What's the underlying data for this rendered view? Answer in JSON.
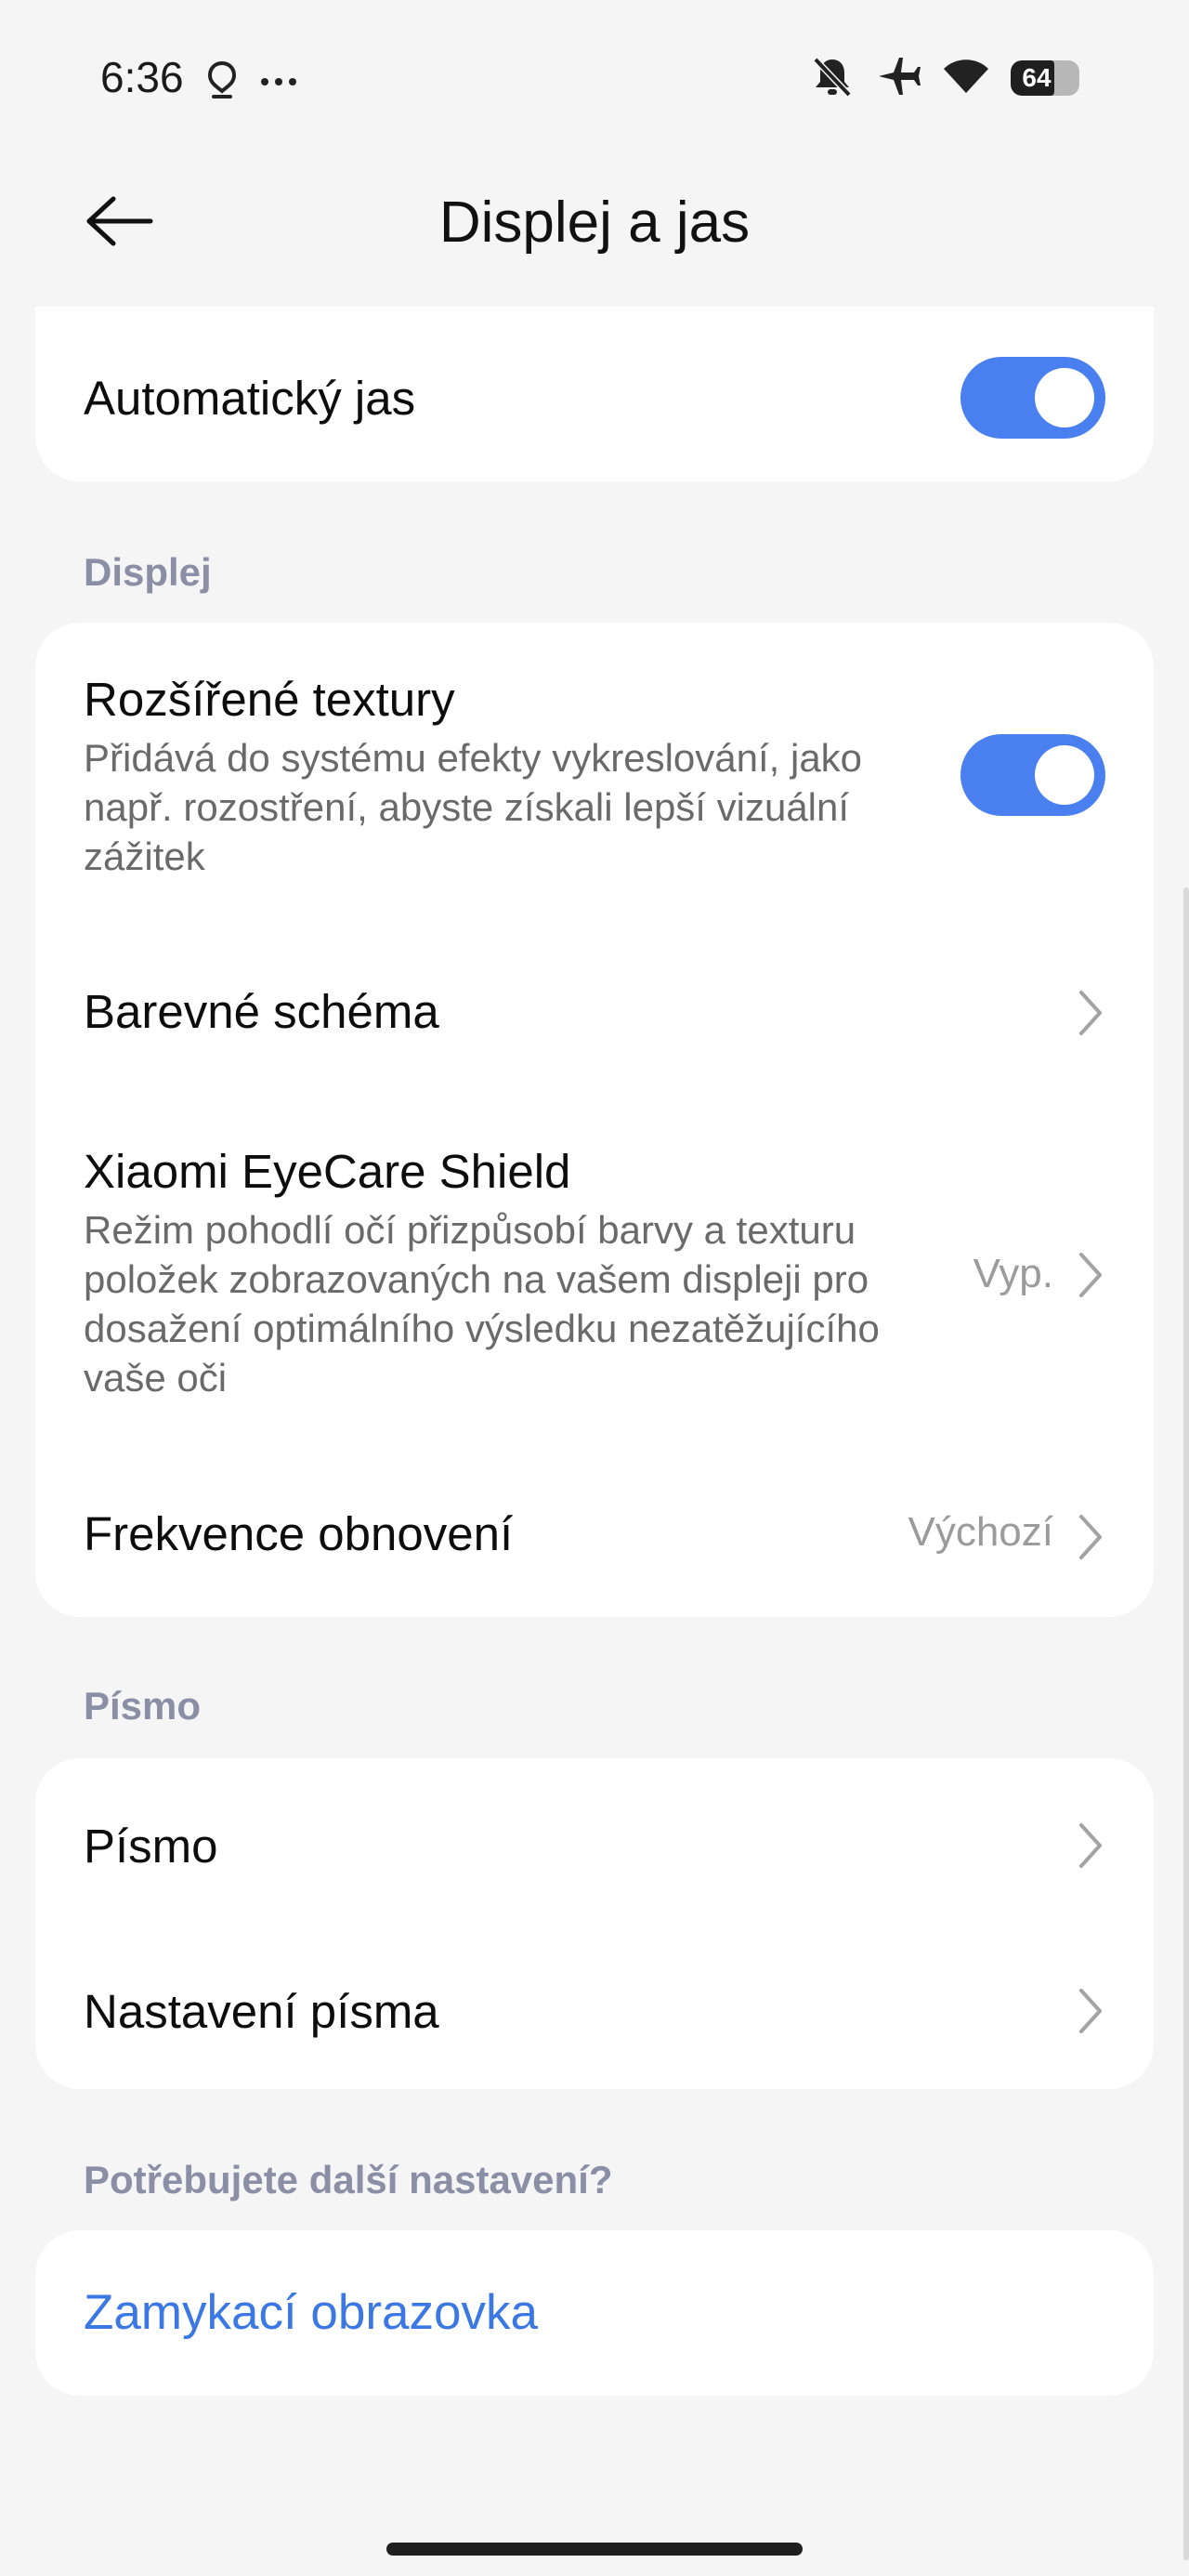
{
  "status_bar": {
    "time": "6:36",
    "left_icons": [
      "location-pin-icon",
      "more-dots-icon"
    ],
    "right_icons": [
      "notifications-off-icon",
      "airplane-mode-icon",
      "wifi-icon"
    ],
    "battery_level": "64",
    "battery_fraction": 0.64
  },
  "header": {
    "title": "Displej a jas",
    "back_icon": "back-arrow-icon"
  },
  "auto_brightness": {
    "label": "Automatický jas",
    "enabled": true
  },
  "sections": {
    "display_label": "Displej",
    "font_label": "Písmo",
    "more_label": "Potřebujete další nastavení?"
  },
  "display": {
    "enhanced_textures": {
      "title": "Rozšířené textury",
      "description": "Přidává do systému efekty vykreslování, jako např. rozostření, abyste získali lepší vizuální zážitek",
      "enabled": true
    },
    "color_scheme": {
      "title": "Barevné schéma"
    },
    "eyecare": {
      "title": "Xiaomi EyeCare Shield",
      "description": "Režim pohodlí očí přizpůsobí barvy a texturu položek zobrazovaných na vašem displeji pro dosažení optimálního výsledku nezatěžujícího vaše oči",
      "value": "Vyp."
    },
    "refresh_rate": {
      "title": "Frekvence obnovení",
      "value": "Výchozí"
    }
  },
  "font": {
    "font_item": "Písmo",
    "font_settings": "Nastavení písma"
  },
  "more": {
    "lock_screen_link": "Zamykací obrazovka"
  },
  "colors": {
    "accent": "#4a7ff0",
    "link": "#3b78e3",
    "section_label": "#8a8fa6",
    "background": "#f5f5f5",
    "card": "#ffffff"
  }
}
